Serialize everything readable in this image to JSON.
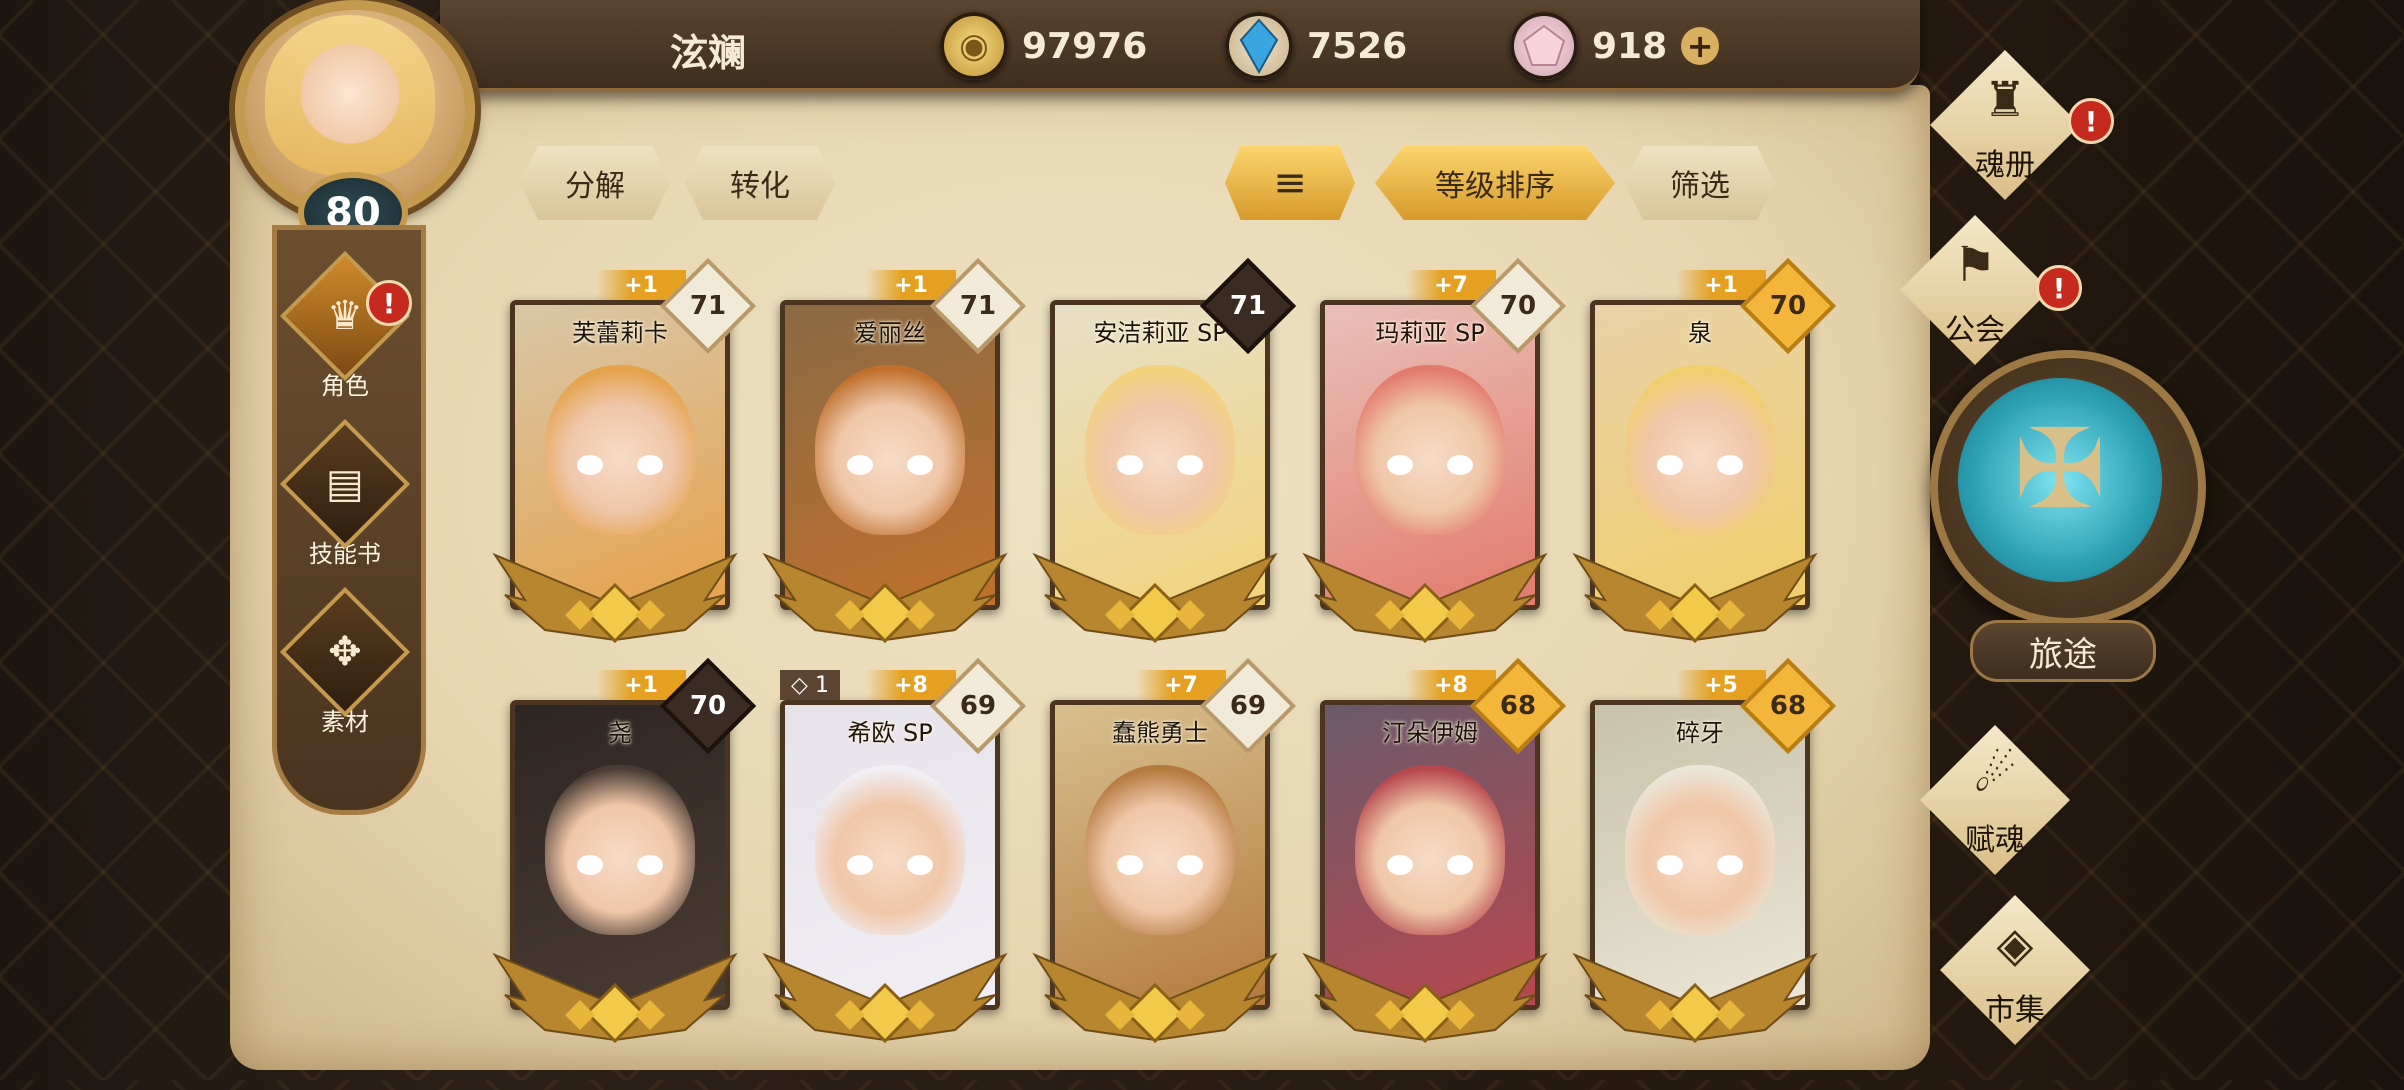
{
  "player": {
    "name": "泫斓",
    "level": "80"
  },
  "currencies": {
    "gold": "97976",
    "crystal": "7526",
    "gem": "918",
    "add": "+"
  },
  "actions": {
    "decompose": "分解",
    "convert": "转化",
    "sort_icon": "≡",
    "sort_label": "等级排序",
    "filter": "筛选"
  },
  "sidebar": [
    {
      "label": "角色",
      "icon": "character-helmet-icon",
      "glyph": "♛",
      "alert": "!",
      "active": true
    },
    {
      "label": "技能书",
      "icon": "skill-book-icon",
      "glyph": "▤",
      "alert": "",
      "active": false
    },
    {
      "label": "素材",
      "icon": "material-icon",
      "glyph": "✥",
      "alert": "",
      "active": false
    }
  ],
  "right_nav": {
    "soul_book": {
      "label": "魂册",
      "alert": "!"
    },
    "guild": {
      "label": "公会",
      "alert": "!"
    },
    "journey": {
      "label": "旅途"
    },
    "endow_soul": {
      "label": "赋魂"
    },
    "market": {
      "label": "市集"
    }
  },
  "heroes": [
    {
      "name": "芙蕾莉卡",
      "level": "71",
      "plus": "+1",
      "extra": "",
      "level_style": "light"
    },
    {
      "name": "爱丽丝",
      "level": "71",
      "plus": "+1",
      "extra": "",
      "level_style": "light"
    },
    {
      "name": "安洁莉亚 SP",
      "level": "71",
      "plus": "",
      "extra": "",
      "level_style": "dark"
    },
    {
      "name": "玛莉亚 SP",
      "level": "70",
      "plus": "+7",
      "extra": "",
      "level_style": "light"
    },
    {
      "name": "泉",
      "level": "70",
      "plus": "+1",
      "extra": "",
      "level_style": "gold"
    },
    {
      "name": "尧",
      "level": "70",
      "plus": "+1",
      "extra": "",
      "level_style": "dark"
    },
    {
      "name": "希欧 SP",
      "level": "69",
      "plus": "+8",
      "extra": "◇ 1",
      "level_style": "light"
    },
    {
      "name": "蠢熊勇士",
      "level": "69",
      "plus": "+7",
      "extra": "",
      "level_style": "light"
    },
    {
      "name": "汀朵伊姆",
      "level": "68",
      "plus": "+8",
      "extra": "",
      "level_style": "gold"
    },
    {
      "name": "碎牙",
      "level": "68",
      "plus": "+5",
      "extra": "",
      "level_style": "gold"
    }
  ],
  "colors": {
    "accent_gold": "#e5a021",
    "parchment": "#e6d6b0",
    "alert_red": "#c62a1f",
    "journey_teal": "#2ca1b4"
  }
}
